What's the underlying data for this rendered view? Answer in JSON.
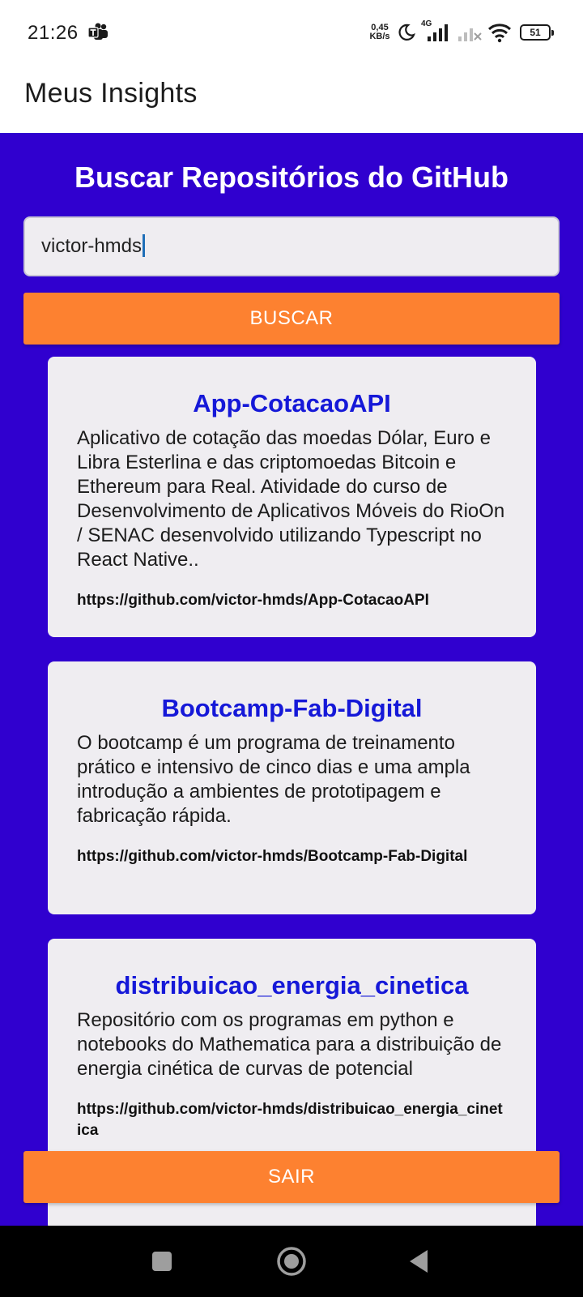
{
  "status_bar": {
    "time": "21:26",
    "net_speed_value": "0,45",
    "net_speed_unit": "KB/s",
    "network_type": "4G",
    "battery": "51"
  },
  "app_bar": {
    "title": "Meus Insights"
  },
  "main": {
    "heading": "Buscar Repositórios do GitHub",
    "search_value": "victor-hmds",
    "search_button": "BUSCAR",
    "exit_button": "SAIR",
    "background_color": "#3000cf",
    "accent_color": "#fd8130"
  },
  "repos": [
    {
      "name": "App-CotacaoAPI",
      "description": "Aplicativo de cotação das moedas Dólar, Euro e Libra Esterlina e das criptomoedas Bitcoin e Ethereum para Real. Atividade do curso de Desenvolvimento de Aplicativos Móveis do RioOn / SENAC desenvolvido utilizando Typescript no React Native..",
      "url": "https://github.com/victor-hmds/App-CotacaoAPI"
    },
    {
      "name": "Bootcamp-Fab-Digital",
      "description": "O bootcamp é um programa de treinamento prático e intensivo de cinco dias e uma ampla introdução a ambientes de prototipagem e fabricação rápida.",
      "url": "https://github.com/victor-hmds/Bootcamp-Fab-Digital"
    },
    {
      "name": "distribuicao_energia_cinetica",
      "description": "Repositório com os programas em python e notebooks do Mathematica para a distribuição de energia cinética de curvas de potencial",
      "url": "https://github.com/victor-hmds/distribuicao_energia_cinetica"
    }
  ],
  "nav_bar": {
    "icons": [
      "recents-square-icon",
      "home-circle-icon",
      "back-triangle-icon"
    ]
  }
}
